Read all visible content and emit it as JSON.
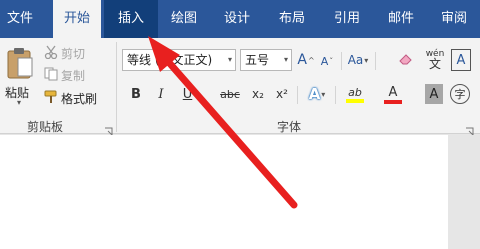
{
  "tabs": [
    {
      "label": "文件"
    },
    {
      "label": "开始"
    },
    {
      "label": "插入"
    },
    {
      "label": "绘图"
    },
    {
      "label": "设计"
    },
    {
      "label": "布局"
    },
    {
      "label": "引用"
    },
    {
      "label": "邮件"
    },
    {
      "label": "审阅"
    }
  ],
  "clipboard": {
    "paste_label": "粘贴",
    "cut_label": "剪切",
    "copy_label": "复制",
    "format_painter_label": "格式刷",
    "group_label": "剪贴板"
  },
  "font": {
    "font_name": "等线 (中文正文)",
    "font_size": "五号",
    "group_label": "字体",
    "wen_label": "wén",
    "bold": "B",
    "italic": "I",
    "underline": "U",
    "strike": "abc",
    "subscript": "x₂",
    "superscript": "x²",
    "grow": "A",
    "shrink": "A",
    "case": "Aa",
    "clear": "A",
    "text_effect": "A",
    "highlight": "ab",
    "font_color": "A",
    "char_shading": "A",
    "enclose": "字",
    "border": "A",
    "phonetic": "文"
  },
  "colors": {
    "accent": "#2b579a",
    "pressed_tab": "#123f7a",
    "arrow": "#e8201f",
    "font_color_bar": "#e8201f",
    "highlight_bar": "#ffff00"
  },
  "icons": [
    "paste-icon",
    "cut-icon",
    "copy-icon",
    "format-painter-icon",
    "dialog-launcher-icon"
  ]
}
